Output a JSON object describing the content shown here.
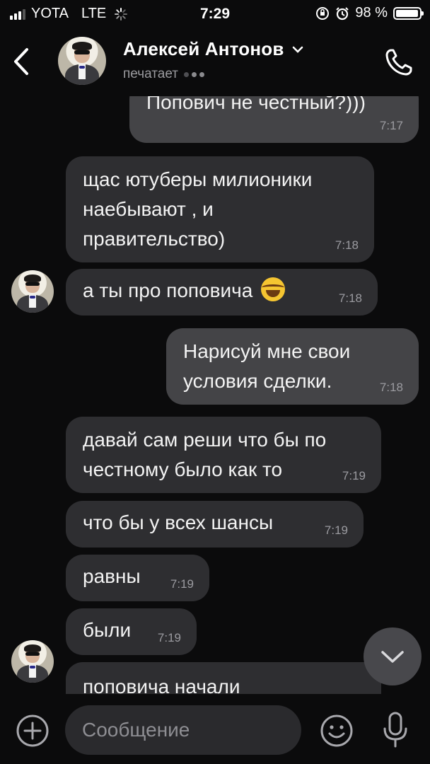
{
  "status_bar": {
    "carrier": "YOTA",
    "network": "LTE",
    "time": "7:29",
    "battery": "98 %",
    "battery_level": 0.98
  },
  "header": {
    "contact_name": "Алексей Антонов",
    "status": "печатает",
    "back_icon": "chevron-left-icon",
    "call_icon": "phone-icon"
  },
  "messages": [
    {
      "dir": "out",
      "text": "Попович не честный?)))",
      "time": "7:17"
    },
    {
      "dir": "in",
      "text": "щас ютуберы милионики\nнаебывают , и\nправительство)",
      "time": "7:18"
    },
    {
      "dir": "in",
      "text": "а ты про поповича",
      "time": "7:18",
      "emoji": "face-with-tears-of-joy"
    },
    {
      "dir": "out",
      "text": "Нарисуй мне свои\nусловия сделки.",
      "time": "7:18"
    },
    {
      "dir": "in",
      "text": "давай сам реши что бы по\nчестному было как то",
      "time": "7:19"
    },
    {
      "dir": "in",
      "text": "что бы у всех шансы",
      "time": "7:19"
    },
    {
      "dir": "in",
      "text": "равны",
      "time": "7:19"
    },
    {
      "dir": "in",
      "text": "были",
      "time": "7:19"
    },
    {
      "dir": "in",
      "text": "поповича начали",
      "time": ""
    }
  ],
  "composer": {
    "placeholder": "Сообщение",
    "value": ""
  },
  "colors": {
    "background": "#0b0b0c",
    "incoming_bubble": "#2e2e31",
    "outgoing_bubble": "#444447",
    "secondary_text": "#9b9ba0"
  }
}
